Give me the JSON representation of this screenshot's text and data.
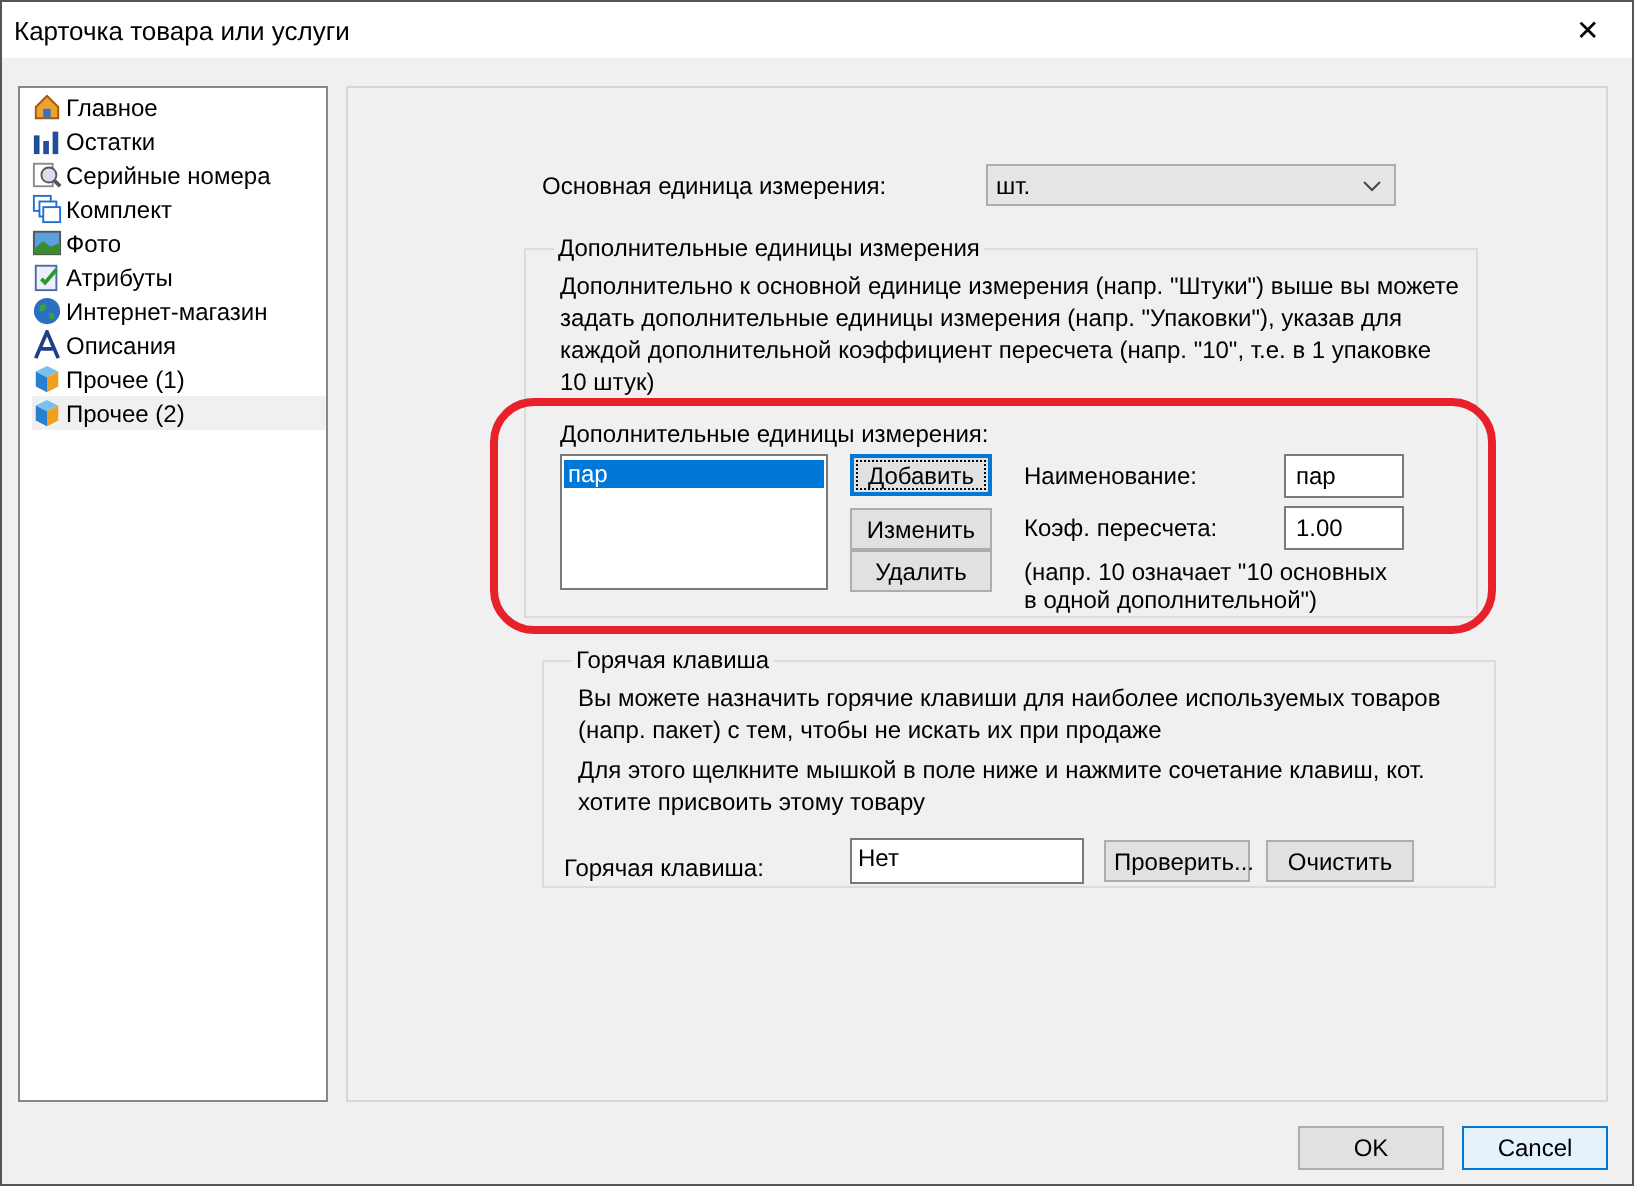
{
  "window": {
    "title": "Карточка товара или услуги",
    "close": "✕"
  },
  "sidebar": {
    "items": [
      {
        "label": "Главное",
        "selected": false
      },
      {
        "label": "Остатки",
        "selected": false
      },
      {
        "label": "Серийные номера",
        "selected": false
      },
      {
        "label": "Комплект",
        "selected": false
      },
      {
        "label": "Фото",
        "selected": false
      },
      {
        "label": "Атрибуты",
        "selected": false
      },
      {
        "label": "Интернет-магазин",
        "selected": false
      },
      {
        "label": "Описания",
        "selected": false
      },
      {
        "label": "Прочее (1)",
        "selected": false
      },
      {
        "label": "Прочее (2)",
        "selected": true
      }
    ]
  },
  "base_unit": {
    "label": "Основная единица измерения:",
    "value": "шт."
  },
  "extra_units": {
    "legend": "Дополнительные единицы измерения",
    "description": "Дополнительно к основной единице измерения (напр. \"Штуки\") выше вы можете задать дополнительные единицы измерения (напр. \"Упаковки\"), указав для каждой дополнительной коэффициент пересчета (напр. \"10\", т.е. в 1 упаковке 10 штук)",
    "list_label": "Дополнительные единицы измерения:",
    "list": [
      {
        "label": "пар",
        "selected": true
      }
    ],
    "buttons": [
      {
        "label": "Добавить",
        "focused": true
      },
      {
        "label": "Изменить",
        "focused": false
      },
      {
        "label": "Удалить",
        "focused": false
      }
    ],
    "name_label": "Наименование:",
    "name_value": "пар",
    "factor_label": "Коэф. пересчета:",
    "factor_value": "1.00",
    "hint": "(напр. 10 означает \"10 основных в одной дополнительной\")"
  },
  "hotkey": {
    "legend": "Горячая клавиша",
    "text_1": "Вы можете назначить горячие клавиши для наиболее используемых товаров (напр. пакет) с тем, чтобы не искать их при продаже",
    "text_2": "Для этого щелкните мышкой в поле ниже и нажмите сочетание клавиш, кот. хотите присвоить этому товару",
    "label": "Горячая клавиша:",
    "value": "Нет",
    "check_button": "Проверить...",
    "clear_button": "Очистить"
  },
  "footer": {
    "buttons": [
      {
        "label": "OK",
        "focused": false
      },
      {
        "label": "Cancel",
        "focused": true
      }
    ]
  }
}
